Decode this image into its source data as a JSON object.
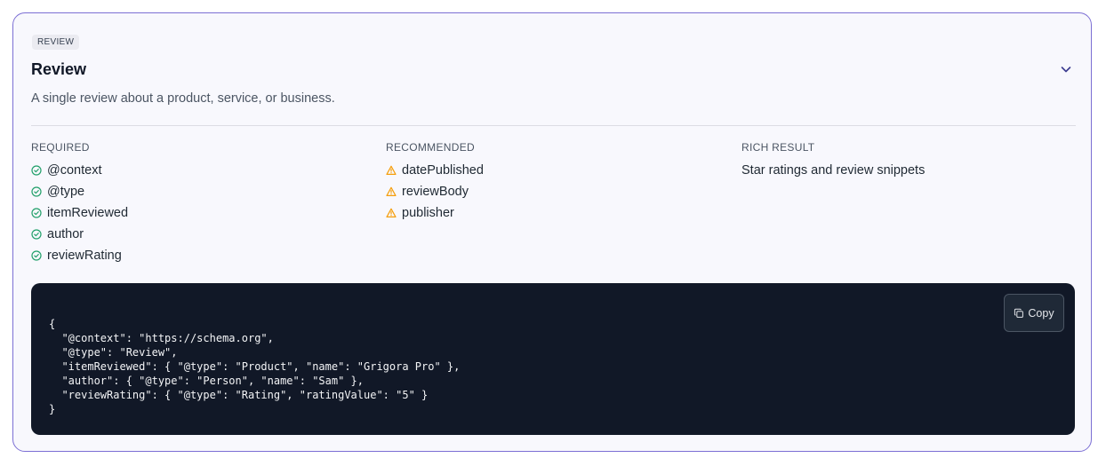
{
  "card": {
    "badge": "REVIEW",
    "title": "Review",
    "description": "A single review about a product, service, or business.",
    "accent_color": "#7c6fd4",
    "icons": {
      "toggle": "chevron-down-icon",
      "required": "check-circle-icon",
      "recommended": "warning-triangle-icon",
      "copy": "copy-icon"
    }
  },
  "required": {
    "heading": "REQUIRED",
    "color": "#22a06b",
    "items": [
      "@context",
      "@type",
      "itemReviewed",
      "author",
      "reviewRating"
    ]
  },
  "recommended": {
    "heading": "RECOMMENDED",
    "color": "#f59e0b",
    "items": [
      "datePublished",
      "reviewBody",
      "publisher"
    ]
  },
  "rich_result": {
    "heading": "RICH RESULT",
    "text": "Star ratings and review snippets"
  },
  "code": {
    "copy_label": "Copy",
    "text": "{\n  \"@context\": \"https://schema.org\",\n  \"@type\": \"Review\",\n  \"itemReviewed\": { \"@type\": \"Product\", \"name\": \"Grigora Pro\" },\n  \"author\": { \"@type\": \"Person\", \"name\": \"Sam\" },\n  \"reviewRating\": { \"@type\": \"Rating\", \"ratingValue\": \"5\" }\n}"
  }
}
